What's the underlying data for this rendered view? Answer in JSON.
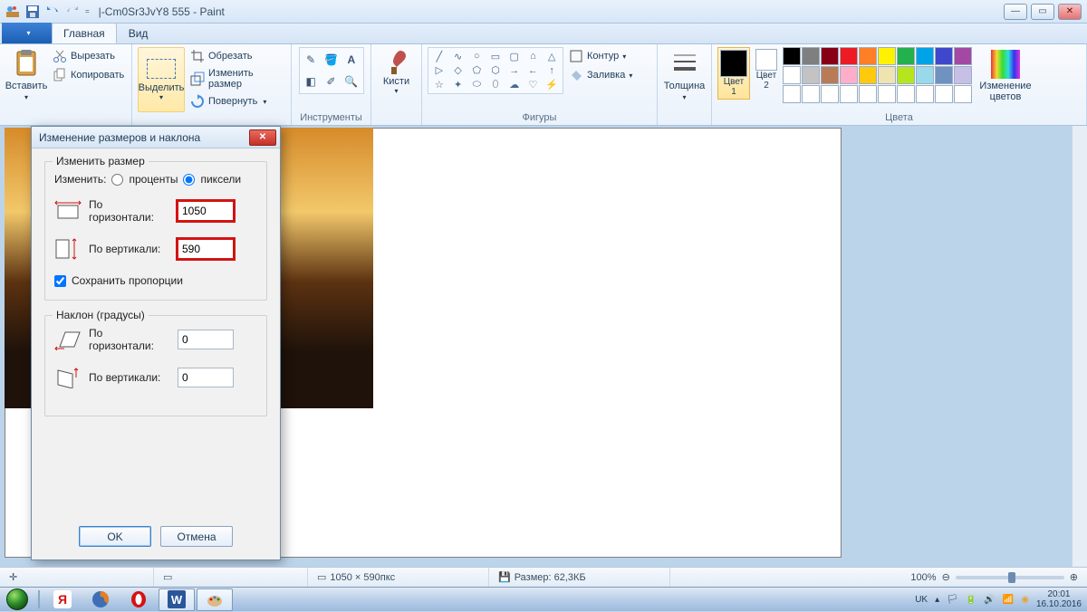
{
  "title": "|-Cm0Sr3JvY8  555 - Paint",
  "tabs": {
    "file": "",
    "main": "Главная",
    "view": "Вид"
  },
  "ribbon": {
    "clipboard": {
      "paste": "Вставить",
      "cut": "Вырезать",
      "copy": "Копировать",
      "label": ""
    },
    "image": {
      "select": "Выделить",
      "crop": "Обрезать",
      "resize": "Изменить размер",
      "rotate": "Повернуть",
      "label": ""
    },
    "tools": {
      "label": "Инструменты"
    },
    "brushes": {
      "label": "Кисти"
    },
    "shapes": {
      "outline": "Контур",
      "fill": "Заливка",
      "label": "Фигуры"
    },
    "size": {
      "thickness": "Толщина"
    },
    "colors": {
      "c1": "Цвет\n1",
      "c2": "Цвет\n2",
      "edit": "Изменение\nцветов",
      "label": "Цвета"
    }
  },
  "palette_row1": [
    "#000000",
    "#7f7f7f",
    "#880015",
    "#ed1c24",
    "#ff7f27",
    "#fff200",
    "#22b14c",
    "#00a2e8",
    "#3f48cc",
    "#a349a4"
  ],
  "palette_row2": [
    "#ffffff",
    "#c3c3c3",
    "#b97a57",
    "#ffaec9",
    "#ffc90e",
    "#efe4b0",
    "#b5e61d",
    "#99d9ea",
    "#7092be",
    "#c8bfe7"
  ],
  "palette_row3": [
    "#ffffff",
    "#ffffff",
    "#ffffff",
    "#ffffff",
    "#ffffff",
    "#ffffff",
    "#ffffff",
    "#ffffff",
    "#ffffff",
    "#ffffff"
  ],
  "dialog": {
    "title": "Изменение размеров и наклона",
    "resize_legend": "Изменить размер",
    "by_label": "Изменить:",
    "opt_percent": "проценты",
    "opt_pixels": "пиксели",
    "h_label": "По\nгоризонтали:",
    "v_label": "По вертикали:",
    "h_value": "1050",
    "v_value": "590",
    "keep_ratio": "Сохранить пропорции",
    "skew_legend": "Наклон (градусы)",
    "skew_h": "0",
    "skew_v": "0",
    "ok": "OK",
    "cancel": "Отмена"
  },
  "status": {
    "dims": "1050 × 590пкс",
    "size": "Размер: 62,3КБ",
    "zoom": "100%"
  },
  "tray": {
    "lang": "UK",
    "time": "20:01",
    "date": "16.10.2016"
  }
}
